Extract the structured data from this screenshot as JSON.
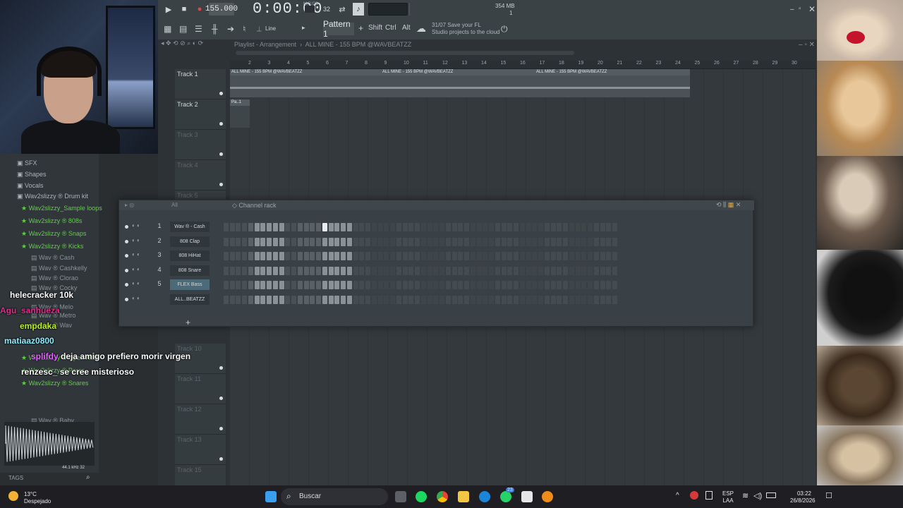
{
  "toolbar": {
    "tempo": "155.000",
    "timecode": "0:00:00",
    "time_format": "M:S:CS",
    "memory": "354 MB",
    "cpu": "1",
    "snap": "Line",
    "pattern": "Pattern 1",
    "shift": "Shift",
    "ctrl": "Ctrl",
    "alt": "Alt",
    "hint_date": "31/07",
    "hint_line1": "Save your FL",
    "hint_line2": "Studio projects to the cloud",
    "steps_label": "32"
  },
  "playlist": {
    "title": "Playlist - Arrangement",
    "project": "ALL MINE - 155 BPM @WAVBEATZZ",
    "ruler": [
      "2",
      "3",
      "4",
      "5",
      "6",
      "7",
      "8",
      "9",
      "10",
      "11",
      "12",
      "13",
      "14",
      "15",
      "16",
      "17",
      "18",
      "19",
      "20",
      "21",
      "22",
      "23",
      "24",
      "25",
      "26",
      "27",
      "28",
      "29",
      "30"
    ],
    "tracks": [
      {
        "label": "Track 1"
      },
      {
        "label": "Track 2"
      },
      {
        "label": "Track 3"
      },
      {
        "label": "Track 4"
      },
      {
        "label": "Track 5"
      },
      {
        "label": "Track 10"
      },
      {
        "label": "Track 11"
      },
      {
        "label": "Track 12"
      },
      {
        "label": "Track 13"
      },
      {
        "label": "Track 15"
      }
    ],
    "clip_audio": "ALL MINE - 155 BPM @WAVBEATZZ",
    "clip_pattern": "Pa..1"
  },
  "channel_rack": {
    "title": "Channel rack",
    "filter": "All",
    "channels": [
      {
        "num": "1",
        "name": "Wav ® - Cash"
      },
      {
        "num": "2",
        "name": "808 Clap"
      },
      {
        "num": "3",
        "name": "808 HiHat"
      },
      {
        "num": "4",
        "name": "808 Snare"
      },
      {
        "num": "5",
        "name": "FLEX Bass"
      },
      {
        "num": "",
        "name": "ALL..BEATZZ"
      }
    ],
    "add_label": "+"
  },
  "browser": {
    "items": [
      {
        "label": "SFX",
        "kind": "folder"
      },
      {
        "label": "Shapes",
        "kind": "folder"
      },
      {
        "label": "Vocals",
        "kind": "folder"
      },
      {
        "label": "Wav2slizzy ® Drum kit",
        "kind": "folder"
      },
      {
        "label": "Wav2slizzy_Sample loops",
        "kind": "star"
      },
      {
        "label": "Wav2slizzy ® 808s",
        "kind": "star"
      },
      {
        "label": "Wav2slizzy ® Snaps",
        "kind": "star"
      },
      {
        "label": "Wav2slizzy ® Kicks",
        "kind": "star"
      },
      {
        "label": "Wav ®   Cash",
        "kind": "wav"
      },
      {
        "label": "Wav ®   Cashkelly",
        "kind": "wav"
      },
      {
        "label": "Wav ®   Clorao",
        "kind": "wav"
      },
      {
        "label": "Wav ®   Cocky",
        "kind": "wav"
      },
      {
        "label": "Wav ®   Melo",
        "kind": "wav"
      },
      {
        "label": "Wav ®   Metro",
        "kind": "wav"
      },
      {
        "label": "Wav ®   Wav",
        "kind": "wav"
      },
      {
        "label": "Wav2slizzy ® Open Hats",
        "kind": "star"
      },
      {
        "label": "Wav2slizzy ® Percs",
        "kind": "star"
      },
      {
        "label": "Wav2slizzy ® Snares",
        "kind": "star"
      },
      {
        "label": "Wav ®   Baby",
        "kind": "wav"
      }
    ],
    "sample_rate": "44.1 kHz 32",
    "tags": "TAGS"
  },
  "chat": [
    {
      "user": "helecracker",
      "msg": "10k",
      "color": "#ffffff"
    },
    {
      "user": "Agu_sanhueza",
      "msg": "",
      "color": "#e02e8e"
    },
    {
      "user": "empdaka",
      "msg": "",
      "color": "#b9f01c"
    },
    {
      "user": "matiaaz0800",
      "msg": "",
      "color": "#8cf0ff"
    },
    {
      "user": "splifdy",
      "msg": "deja amigo prefiero morir virgen",
      "color": "#e066ff"
    },
    {
      "user": "renzesc_",
      "msg": "se cree misterioso",
      "color": "#ffffff"
    }
  ],
  "taskbar": {
    "temp": "13°C",
    "weather": "Despejado",
    "search": "Buscar",
    "lang1": "ESP",
    "lang2": "LAA",
    "time": "03:22",
    "date": "26/8/2026",
    "badge": "23"
  }
}
